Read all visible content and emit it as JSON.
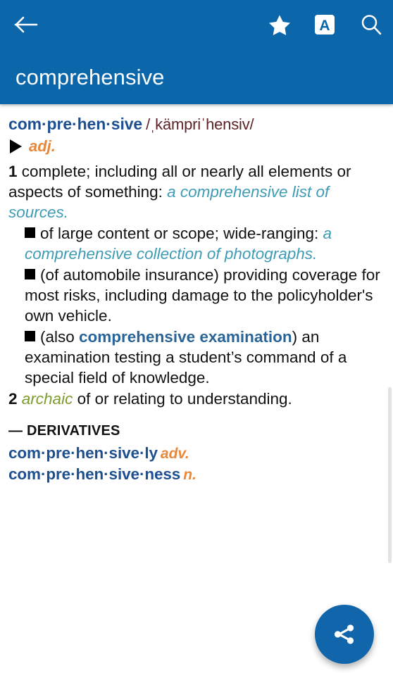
{
  "appbar": {
    "title": "comprehensive",
    "back_icon": "back-arrow-icon",
    "star_icon": "star-bookmark-icon",
    "font_icon": "font-size-icon",
    "font_icon_letter": "A",
    "search_icon": "search-icon",
    "background_color": "#0b66aa"
  },
  "entry": {
    "headword": "com·pre·hen·sive",
    "pronunciation": "/ˌkämpriˈhensiv/",
    "part_of_speech": "adj.",
    "audio_icon": "play-audio-triangle-icon",
    "senses": [
      {
        "number": "1",
        "text": "complete; including all or nearly all elements or aspects of something: ",
        "example": "a comprehensive list of sources."
      },
      {
        "number": "2",
        "label": "archaic",
        "text": "of or relating to understanding.",
        "example": ""
      }
    ],
    "subsenses": [
      {
        "text_before": "of large content or scope; wide-ranging: ",
        "example": "a comprehensive collection of photographs.",
        "text_after": ""
      },
      {
        "text_before": "(of automobile insurance) providing coverage for most risks, including damage to the policyholder's own vehicle.",
        "example": "",
        "text_after": ""
      },
      {
        "text_before": "(also ",
        "xref": "comprehensive examination",
        "text_after": ") an examination testing a student’s command of a special field of knowledge."
      }
    ],
    "derivatives_heading": "— DERIVATIVES",
    "derivatives": [
      {
        "word": "com·pre·hen·sive·ly",
        "pos": "adv."
      },
      {
        "word": "com·pre·hen·sive·ness",
        "pos": "n."
      }
    ]
  },
  "fab": {
    "icon": "share-icon",
    "color": "#1166ab"
  },
  "colors": {
    "headword_blue": "#1d4f91",
    "pronunciation_maroon": "#5e2326",
    "example_teal": "#3e9bb5",
    "pos_orange": "#e8883a",
    "xref_blue": "#2a6496",
    "archaic_olive": "#7d9c2c"
  }
}
